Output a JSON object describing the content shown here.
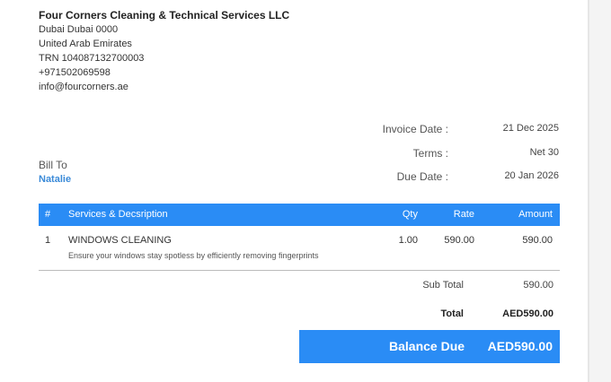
{
  "company": {
    "name": "Four Corners Cleaning & Technical Services LLC",
    "address1": "Dubai Dubai 0000",
    "address2": "United Arab Emirates",
    "trn": "TRN 104087132700003",
    "phone": "+971502069598",
    "email": "info@fourcorners.ae"
  },
  "invoice": {
    "date_label": "Invoice Date :",
    "date_value": "21 Dec 2025",
    "terms_label": "Terms :",
    "terms_value": "Net 30",
    "due_label": "Due Date :",
    "due_value": "20 Jan 2026"
  },
  "bill_to": {
    "label": "Bill To",
    "name": "Natalie"
  },
  "table": {
    "headers": [
      "#",
      "Services & Decsription",
      "Qty",
      "Rate",
      "Amount"
    ],
    "rows": [
      {
        "index": "1",
        "service": "WINDOWS CLEANING",
        "description": "Ensure your windows stay spotless by efficiently removing fingerprints",
        "qty": "1.00",
        "rate": "590.00",
        "amount": "590.00"
      }
    ]
  },
  "totals": {
    "subtotal_label": "Sub Total",
    "subtotal_value": "590.00",
    "total_label": "Total",
    "total_value": "AED590.00",
    "balance_label": "Balance Due",
    "balance_value": "AED590.00"
  },
  "colors": {
    "accent": "#2a8cf5",
    "name_link": "#3a8ad8"
  }
}
